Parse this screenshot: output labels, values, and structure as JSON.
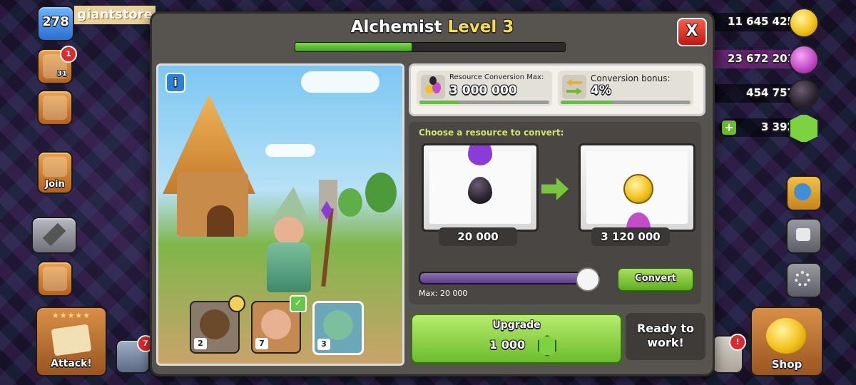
{
  "hud": {
    "trophies": "278",
    "watermark": "giantstore",
    "notification_badge_1": "1",
    "notification_badge_2": "7",
    "join_label": "Join",
    "attack_label": "Attack!",
    "shop_label": "Shop",
    "builder_count": "31",
    "resources": {
      "gold": "11 645 425",
      "elixir": "23 672 201",
      "dark_elixir": "454 757",
      "gems": "3 392"
    }
  },
  "panel": {
    "title_name": "Alchemist",
    "title_level": "Level 3",
    "level_progress": 0.43,
    "close_label": "X",
    "info_label": "i",
    "stats": {
      "conversion_max_label": "Resource Conversion Max:",
      "conversion_max_value": "3 000 000",
      "conversion_max_bar": 0.3,
      "bonus_label": "Conversion bonus:",
      "bonus_value": "4%",
      "bonus_bar": 0.4
    },
    "choose_label": "Choose a resource to convert:",
    "from_amount": "20 000",
    "to_amount": "3 120 000",
    "slider_fraction": 1.0,
    "max_label": "Max: 20 000",
    "convert_button": "Convert",
    "upgrade_label": "Upgrade",
    "upgrade_cost": "1 000",
    "status_text": "Ready to work!",
    "cards": [
      {
        "level": "2",
        "color": "#6a4a2a"
      },
      {
        "level": "7",
        "color": "#e8b191"
      },
      {
        "level": "3",
        "color": "#7bbf9c"
      }
    ]
  },
  "colors": {
    "gold": "#f2c21b",
    "elixir": "#c24cc9",
    "dark_elixir": "#2b2430",
    "gem": "#7bd33f",
    "accent_green": "#6bbd2c"
  }
}
